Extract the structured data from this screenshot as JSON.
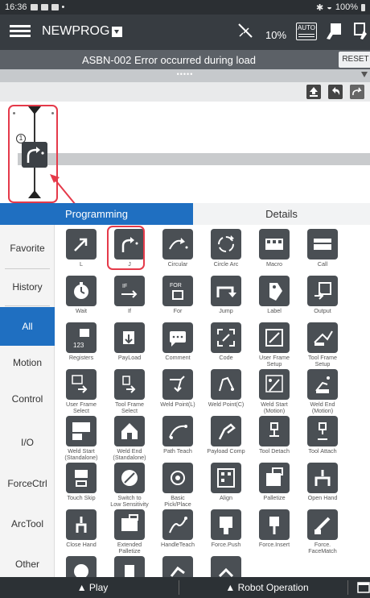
{
  "status_bar": {
    "time": "16:36",
    "battery": "100%"
  },
  "header": {
    "program_name": "NEWPROG",
    "speed": "10%",
    "mode_label": "AUTO"
  },
  "alarm": {
    "message": "ASBN-002  Error occurred during load",
    "reset_label": "RESET"
  },
  "grab_handle": {
    "dots": "•••••"
  },
  "editor": {
    "line_number": "1"
  },
  "tabs": [
    {
      "label": "Programming"
    },
    {
      "label": "Details"
    }
  ],
  "sidebar": [
    {
      "label": "Favorite"
    },
    {
      "label": "History"
    },
    {
      "label": "All"
    },
    {
      "label": "Motion"
    },
    {
      "label": "Control"
    },
    {
      "label": "I/O"
    },
    {
      "label": "ForceCtrl"
    },
    {
      "label": "ArcTool"
    },
    {
      "label": "Other"
    }
  ],
  "commands": [
    {
      "label": "L"
    },
    {
      "label": "J"
    },
    {
      "label": "Circular"
    },
    {
      "label": "Circle Arc"
    },
    {
      "label": "Macro"
    },
    {
      "label": "Call"
    },
    {
      "label": "Wait"
    },
    {
      "label": "If"
    },
    {
      "label": "For"
    },
    {
      "label": "Jump"
    },
    {
      "label": "Label"
    },
    {
      "label": "Output"
    },
    {
      "label": "Registers"
    },
    {
      "label": "PayLoad"
    },
    {
      "label": "Comment"
    },
    {
      "label": "Code"
    },
    {
      "label": "User Frame\nSetup"
    },
    {
      "label": "Tool Frame\nSetup"
    },
    {
      "label": "User Frame\nSelect"
    },
    {
      "label": "Tool Frame\nSelect"
    },
    {
      "label": "Weld Point(L)"
    },
    {
      "label": "Weld Point(C)"
    },
    {
      "label": "Weld Start\n(Motion)"
    },
    {
      "label": "Weld End\n(Motion)"
    },
    {
      "label": "Weld Start\n(Standalone)"
    },
    {
      "label": "Weld End\n(Standalone)"
    },
    {
      "label": "Path Teach"
    },
    {
      "label": "Payload Comp"
    },
    {
      "label": "Tool Detach"
    },
    {
      "label": "Tool Attach"
    },
    {
      "label": "Touch Skip"
    },
    {
      "label": "Switch to\nLow Sensitivity"
    },
    {
      "label": "Basic\nPick/Place"
    },
    {
      "label": "Align"
    },
    {
      "label": "Palletize"
    },
    {
      "label": "Open Hand"
    },
    {
      "label": "Close Hand"
    },
    {
      "label": "Extended\nPalletize"
    },
    {
      "label": "HandleTeach"
    },
    {
      "label": "Force.Push"
    },
    {
      "label": "Force.Insert"
    },
    {
      "label": "Force.\nFaceMatch"
    },
    {
      "label": ""
    },
    {
      "label": ""
    },
    {
      "label": ""
    },
    {
      "label": ""
    }
  ],
  "footer": {
    "play_label": "▲ Play",
    "robot_label": "▲ Robot Operation"
  }
}
